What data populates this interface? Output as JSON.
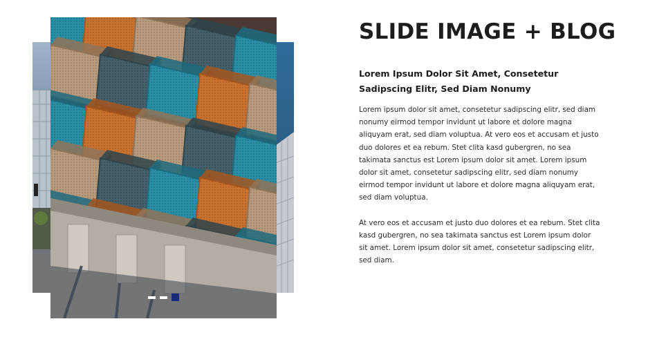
{
  "title": "SLIDE IMAGE + BLOG",
  "subheading": "Lorem Ipsum Dolor Sit Amet, Consetetur Sadipscing Elitr, Sed Diam Nonumy",
  "paragraphs": [
    "Lorem ipsum dolor sit amet, consetetur sadipscing elitr, sed diam nonumy eirmod tempor invidunt ut labore et dolore magna aliquyam erat, sed diam voluptua. At vero eos et accusam et justo duo dolores et ea rebum. Stet clita kasd gubergren, no sea takimata sanctus est Lorem ipsum dolor sit amet. Lorem ipsum dolor sit amet, consetetur sadipscing elitr, sed diam nonumy eirmod tempor invidunt ut labore et dolore magna aliquyam erat, sed diam voluptua.",
    "At vero eos et accusam et justo duo dolores et ea rebum. Stet clita kasd gubergren, no sea takimata sanctus est Lorem ipsum dolor sit amet. Lorem ipsum dolor sit amet, consetetur sadipscing elitr, sed diam."
  ],
  "slider": {
    "slide_count": 3,
    "active_index": 2,
    "colors": {
      "dot_inactive": "#ffffff",
      "dot_active": "#1a2a7a",
      "balcony_orange": "#c9712e",
      "balcony_teal": "#2a8fa6",
      "concrete": "#b7b1a8"
    }
  }
}
